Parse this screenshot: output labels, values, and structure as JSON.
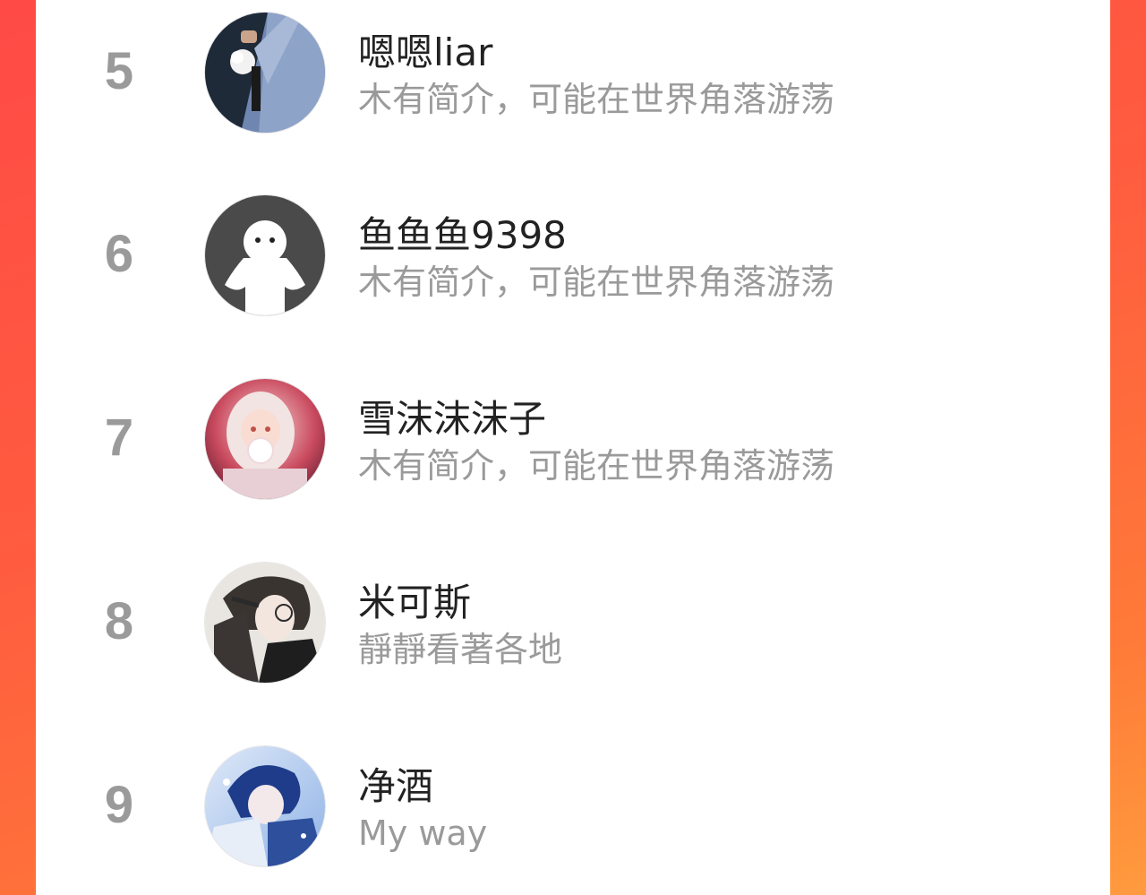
{
  "ranking": {
    "items": [
      {
        "rank": "5",
        "name": "嗯嗯liar",
        "bio": "木有简介，可能在世界角落游荡",
        "avatar_icon": "avatar-photo-suit-flower-icon"
      },
      {
        "rank": "6",
        "name": "鱼鱼鱼9398",
        "bio": "木有简介，可能在世界角落游荡",
        "avatar_icon": "default-avatar-icon"
      },
      {
        "rank": "7",
        "name": "雪沫沫沫子",
        "bio": "木有简介，可能在世界角落游荡",
        "avatar_icon": "anime-girl-bubble-avatar-icon"
      },
      {
        "rank": "8",
        "name": "米可斯",
        "bio": "靜靜看著各地",
        "avatar_icon": "anime-boy-glasses-avatar-icon"
      },
      {
        "rank": "9",
        "name": "净酒",
        "bio": "My way",
        "avatar_icon": "anime-boy-blue-avatar-icon"
      }
    ]
  },
  "colors": {
    "background_gradient_start": "#ff4a46",
    "background_gradient_end": "#ff9b3e",
    "card": "#ffffff",
    "rank_text": "#9a9a9a",
    "name_text": "#222222",
    "bio_text": "#9a9a9a"
  }
}
